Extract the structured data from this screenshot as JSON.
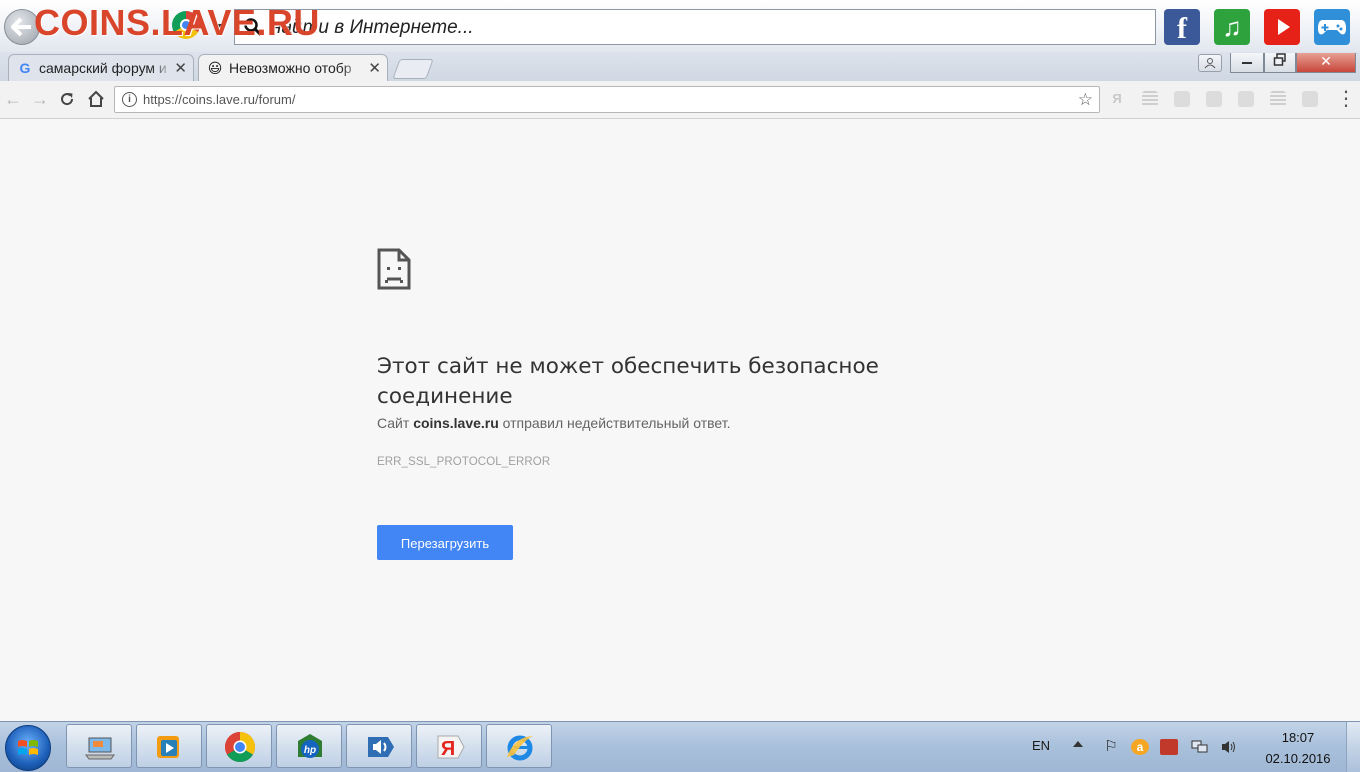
{
  "topbar": {
    "watermark": "COINS.LAVE.RU",
    "search_placeholder": "найти в Интернете..."
  },
  "social": {
    "facebook": "f",
    "music": "♫",
    "youtube_icon": "play-icon",
    "games_icon": "gamepad-icon"
  },
  "tabs": [
    {
      "label": "самарский форум и",
      "favicon": "G"
    },
    {
      "label": "Невозможно отобр",
      "favicon": "😃"
    }
  ],
  "toolbar": {
    "url": "https://coins.lave.ru/forum/",
    "yandex_ext": "Я"
  },
  "error": {
    "title": "Этот сайт не может обеспечить безопасное соединение",
    "desc_prefix": "Сайт ",
    "desc_host": "coins.lave.ru",
    "desc_suffix": " отправил недействительный ответ.",
    "code": "ERR_SSL_PROTOCOL_ERROR",
    "reload_label": "Перезагрузить"
  },
  "taskbar": {
    "lang": "EN",
    "time": "18:07",
    "date": "02.10.2016",
    "yandex_label": "Я"
  },
  "colors": {
    "accent_button": "#4285f4",
    "watermark": "#d8452b",
    "page_bg": "#f7f7f7"
  }
}
